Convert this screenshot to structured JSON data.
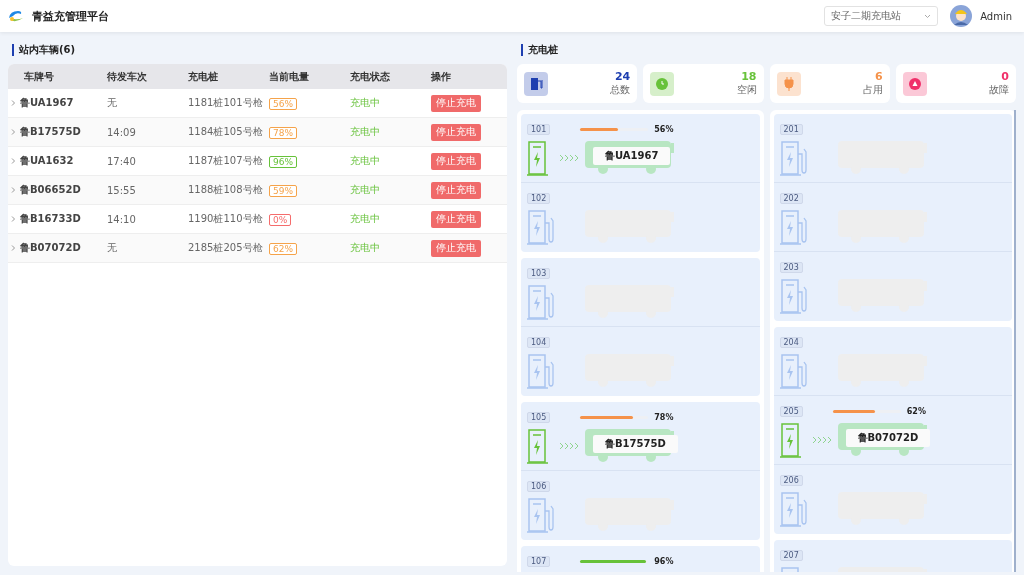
{
  "header": {
    "title": "青益充管理平台",
    "station": "安子二期充电站",
    "user": "Admin"
  },
  "vehicles": {
    "title": "站内车辆(6)",
    "columns": [
      "车牌号",
      "待发车次",
      "充电桩",
      "当前电量",
      "充电状态",
      "操作"
    ],
    "rows": [
      {
        "plate": "鲁UA1967",
        "trip": "无",
        "pile": "1181桩101号枪",
        "charge": "56%",
        "color": "#f5a34a",
        "status": "充电中",
        "action": "停止充电"
      },
      {
        "plate": "鲁B17575D",
        "trip": "14:09",
        "pile": "1184桩105号枪",
        "charge": "78%",
        "color": "#f5a34a",
        "status": "充电中",
        "action": "停止充电"
      },
      {
        "plate": "鲁UA1632",
        "trip": "17:40",
        "pile": "1187桩107号枪",
        "charge": "96%",
        "color": "#67c23a",
        "status": "充电中",
        "action": "停止充电"
      },
      {
        "plate": "鲁B06652D",
        "trip": "15:55",
        "pile": "1188桩108号枪",
        "charge": "59%",
        "color": "#f5a34a",
        "status": "充电中",
        "action": "停止充电"
      },
      {
        "plate": "鲁B16733D",
        "trip": "14:10",
        "pile": "1190桩110号枪",
        "charge": "0%",
        "color": "#f56c6c",
        "status": "充电中",
        "action": "停止充电"
      },
      {
        "plate": "鲁B07072D",
        "trip": "无",
        "pile": "2185桩205号枪",
        "charge": "62%",
        "color": "#f5a34a",
        "status": "充电中",
        "action": "停止充电"
      }
    ]
  },
  "piles": {
    "title": "充电桩",
    "stats": [
      {
        "kind": "total",
        "value": "24",
        "label": "总数",
        "color": "#1e3fb0"
      },
      {
        "kind": "idle",
        "value": "18",
        "label": "空闲",
        "color": "#67c23a"
      },
      {
        "kind": "busy",
        "value": "6",
        "label": "占用",
        "color": "#f5924a"
      },
      {
        "kind": "fault",
        "value": "0",
        "label": "故障",
        "color": "#f0306a"
      }
    ],
    "columns": [
      [
        {
          "ports": [
            {
              "number": "101",
              "occupied": true,
              "level": 0.56,
              "reading": "56%",
              "color": "#f5924a",
              "plate": "鲁UA1967"
            },
            {
              "number": "102",
              "occupied": false
            }
          ]
        },
        {
          "ports": [
            {
              "number": "103",
              "occupied": false
            },
            {
              "number": "104",
              "occupied": false
            }
          ]
        },
        {
          "ports": [
            {
              "number": "105",
              "occupied": true,
              "level": 0.78,
              "reading": "78%",
              "color": "#f5924a",
              "plate": "鲁B17575D"
            },
            {
              "number": "106",
              "occupied": false
            }
          ]
        },
        {
          "ports": [
            {
              "number": "107",
              "occupied": true,
              "level": 0.96,
              "reading": "96%",
              "color": "#67c23a"
            }
          ]
        }
      ],
      [
        {
          "ports": [
            {
              "number": "201",
              "occupied": false
            },
            {
              "number": "202",
              "occupied": false
            },
            {
              "number": "203",
              "occupied": false
            }
          ]
        },
        {
          "ports": [
            {
              "number": "204",
              "occupied": false
            },
            {
              "number": "205",
              "occupied": true,
              "level": 0.62,
              "reading": "62%",
              "color": "#f5924a",
              "plate": "鲁B07072D"
            },
            {
              "number": "206",
              "occupied": false
            }
          ]
        },
        {
          "ports": [
            {
              "number": "207",
              "occupied": false
            }
          ]
        }
      ]
    ]
  }
}
